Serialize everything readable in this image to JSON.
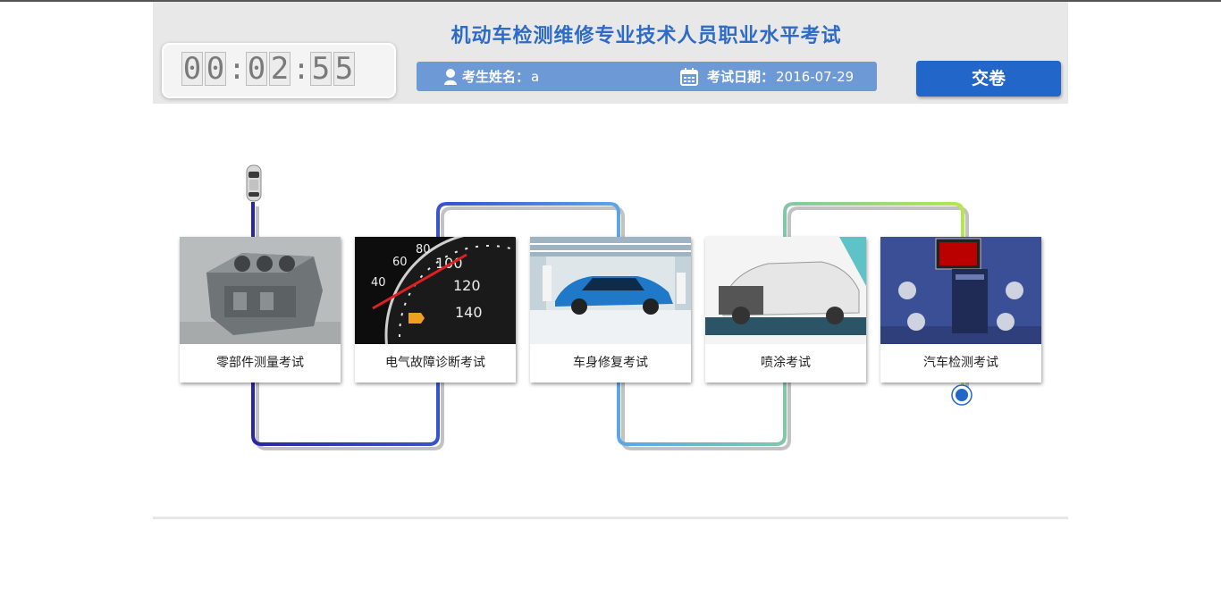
{
  "header": {
    "title": "机动车检测维修专业技术人员职业水平考试",
    "timer_digits": [
      "0",
      "0",
      "0",
      "2",
      "5",
      "5"
    ],
    "timer_sep": ":",
    "name_label": "考生姓名：",
    "name_value": "a",
    "date_label": "考试日期：",
    "date_value": "2016-07-29",
    "submit_label": "交卷",
    "icons": {
      "user": "user-icon",
      "calendar": "calendar-icon"
    }
  },
  "stages": [
    {
      "label": "零部件测量考试",
      "image": "engine-block"
    },
    {
      "label": "电气故障诊断考试",
      "image": "speedometer"
    },
    {
      "label": "车身修复考试",
      "image": "blue-car"
    },
    {
      "label": "喷涂考试",
      "image": "damaged-car"
    },
    {
      "label": "汽车检测考试",
      "image": "wheel-aligner"
    }
  ],
  "progress": {
    "current_stage_index": 4,
    "marker": "car-icon",
    "indicator": "radio-selected-icon"
  },
  "colors": {
    "accent": "#2166c8",
    "title": "#2e6bc6",
    "infobar": "#6d9ad6",
    "header_bg": "#e8e8e8",
    "path_start": "#2e2aa8",
    "path_end": "#b5e84a"
  }
}
